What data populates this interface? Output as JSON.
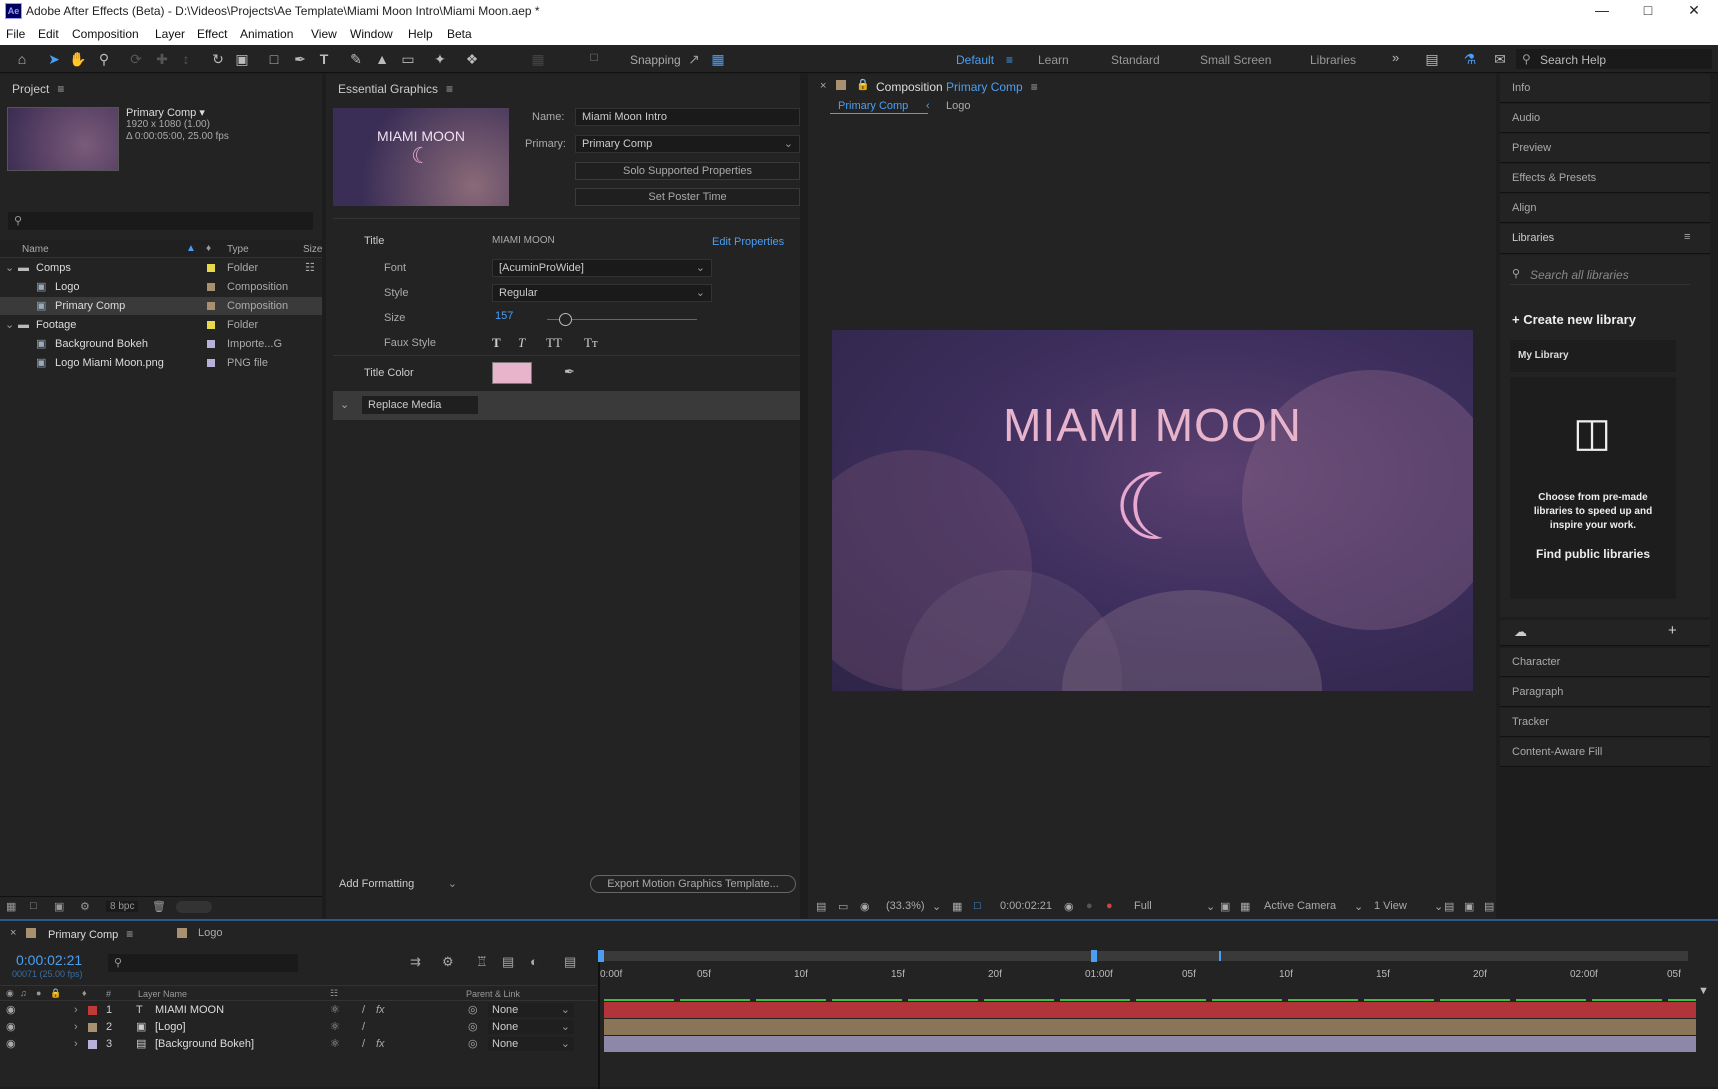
{
  "window": {
    "title": "Adobe After Effects (Beta) - D:\\Videos\\Projects\\Ae Template\\Miami Moon Intro\\Miami Moon.aep *",
    "app_icon": "Ae",
    "controls": [
      "minimize-icon",
      "maximize-icon",
      "close-icon"
    ]
  },
  "menu": [
    "File",
    "Edit",
    "Composition",
    "Layer",
    "Effect",
    "Animation",
    "View",
    "Window",
    "Help",
    "Beta"
  ],
  "toolbar": {
    "snapping": "Snapping",
    "workspaces": [
      "Default",
      "Learn",
      "Standard",
      "Small Screen",
      "Libraries"
    ],
    "active_workspace": "Default",
    "search_placeholder": "Search Help"
  },
  "project": {
    "title": "Project",
    "comp_name": "Primary Comp",
    "comp_info1": "1920 x 1080 (1.00)",
    "comp_info2": "Δ 0:00:05:00, 25.00 fps",
    "search_placeholder": "",
    "cols": {
      "name": "Name",
      "type": "Type",
      "size": "Size"
    },
    "items": [
      {
        "name": "Comps",
        "type": "Folder",
        "color": "#e6d94b"
      },
      {
        "name": "Logo",
        "type": "Composition",
        "color": "#a89070"
      },
      {
        "name": "Primary Comp",
        "type": "Composition",
        "color": "#a89070"
      },
      {
        "name": "Footage",
        "type": "Folder",
        "color": "#e6d94b"
      },
      {
        "name": "Background Bokeh",
        "type": "Importe...G",
        "color": "#b8b0d8"
      },
      {
        "name": "Logo Miami Moon.png",
        "type": "PNG file",
        "color": "#b8b0d8"
      }
    ],
    "bpc": "8 bpc"
  },
  "eg": {
    "title": "Essential Graphics",
    "poster_text": "MIAMI MOON",
    "name_label": "Name:",
    "name_value": "Miami Moon Intro",
    "primary_label": "Primary:",
    "primary_value": "Primary Comp",
    "solo": "Solo Supported Properties",
    "poster": "Set Poster Time",
    "prop_title": "Title",
    "prop_title_value": "MIAMI MOON",
    "edit_props": "Edit Properties",
    "font_label": "Font",
    "font_value": "[AcuminProWide]",
    "style_label": "Style",
    "style_value": "Regular",
    "size_label": "Size",
    "size_value": "157",
    "size_fraction": 0.12,
    "faux_label": "Faux Style",
    "faux": [
      "T",
      "T",
      "TT",
      "Tт"
    ],
    "color_label": "Title Color",
    "title_color": "#e8b4cc",
    "replace_media": "Replace Media",
    "add_formatting": "Add Formatting",
    "export": "Export Motion Graphics Template..."
  },
  "comp": {
    "header": "Composition",
    "header_comp": "Primary Comp",
    "tabs": [
      "Primary Comp",
      "Logo"
    ],
    "text": "MIAMI MOON",
    "zoom": "(33.3%)",
    "time": "0:00:02:21",
    "quality": "Full",
    "camera": "Active Camera",
    "views": "1 View"
  },
  "right": {
    "items_top": [
      "Info",
      "Audio",
      "Preview",
      "Effects & Presets",
      "Align"
    ],
    "libraries": "Libraries",
    "search": "Search all libraries",
    "create": "Create new library",
    "my_library": "My Library",
    "promo": "Choose from pre-made libraries to speed up and inspire your work.",
    "find": "Find public libraries",
    "items_bottom": [
      "Character",
      "Paragraph",
      "Tracker",
      "Content-Aware Fill"
    ]
  },
  "timeline": {
    "tabs": [
      "Primary Comp",
      "Logo"
    ],
    "time": "0:00:02:21",
    "frames": "00071 (25.00 fps)",
    "col_name": "Layer Name",
    "col_parent": "Parent & Link",
    "col_num": "#",
    "ruler": [
      "0:00f",
      "05f",
      "10f",
      "15f",
      "20f",
      "01:00f",
      "05f",
      "10f",
      "15f",
      "20f",
      "02:00f",
      "05f"
    ],
    "layers": [
      {
        "num": "1",
        "name": "MIAMI MOON",
        "parent": "None",
        "color": "#c03a3a",
        "bar": "#b0343a"
      },
      {
        "num": "2",
        "name": "[Logo]",
        "parent": "None",
        "color": "#a89070",
        "bar": "#8a7656"
      },
      {
        "num": "3",
        "name": "[Background Bokeh]",
        "parent": "None",
        "color": "#b8b0d8",
        "bar": "#8e88a8"
      }
    ]
  }
}
